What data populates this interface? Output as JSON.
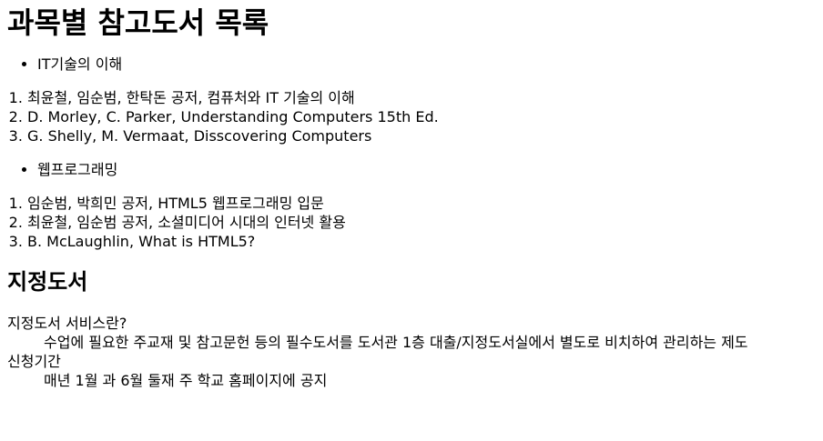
{
  "title": "과목별 참고도서 목록",
  "subjects": [
    {
      "name": "IT기술의 이해",
      "books": [
        "최윤철, 임순범, 한탁돈 공저, 컴퓨처와 IT 기술의 이해",
        "D. Morley, C. Parker, Understanding Computers 15th Ed.",
        "G. Shelly, M. Vermaat, Disscovering Computers"
      ]
    },
    {
      "name": "웹프로그래밍",
      "books": [
        "임순범, 박희민 공저, HTML5 웹프로그래밍 입문",
        "최윤철, 임순범 공저, 소셜미디어 시대의 인터넷 활용",
        "B. McLaughlin, What is HTML5?"
      ]
    }
  ],
  "designated": {
    "heading": "지정도서",
    "terms": [
      {
        "term": "지정도서 서비스란?",
        "definition": "수업에 필요한 주교재 및 참고문헌 등의 필수도서를 도서관 1층 대출/지정도서실에서 별도로 비치하여 관리하는 제도"
      },
      {
        "term": "신청기간",
        "definition": "매년 1월 과 6월 둘재 주 학교 홈페이지에 공지"
      }
    ]
  }
}
